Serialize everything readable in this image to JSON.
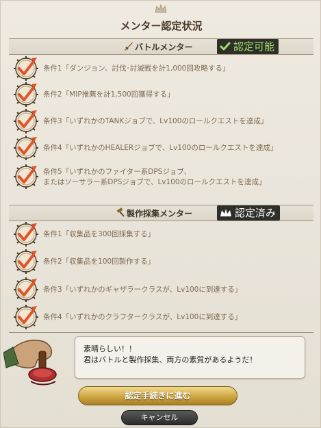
{
  "window": {
    "title": "メンター認定状況"
  },
  "battle": {
    "title": "バトルメンター",
    "status": "認定可能",
    "conditions": [
      "条件1「ダンジョン、討伐･討滅戦を計1,000回攻略する」",
      "条件2「MIP推薦を計1,500回獲得する」",
      "条件3「いずれかのTANKジョブで、Lv100のロールクエストを達成」",
      "条件4「いずれかのHEALERジョブで、Lv100のロールクエストを達成」",
      "条件5「いずれかのファイター系DPSジョブ、",
      "またはソーサラー系DPSジョブで、Lv100のロールクエストを達成」"
    ]
  },
  "crafting": {
    "title": "製作採集メンター",
    "status": "認定済み",
    "conditions": [
      "条件1「収集品を300回採集する」",
      "条件2「収集品を100回製作する」",
      "条件3「いずれかのギャザラークラスが、Lv100に到達する」",
      "条件4「いずれかのクラフタークラスが、Lv100に到達する」"
    ]
  },
  "dialog": {
    "line1": "素晴らしい！！",
    "line2": "君はバトルと製作採集、両方の素質があるようだ！"
  },
  "buttons": {
    "confirm": "認定手続きに進む",
    "cancel": "キャンセル"
  },
  "colors": {
    "check": "#e0542a",
    "badge_bg": "#2f2f2a",
    "battle_status": "#9fe06a",
    "crafting_status": "#ffffff",
    "confirm_gold": "#c9a13d"
  }
}
